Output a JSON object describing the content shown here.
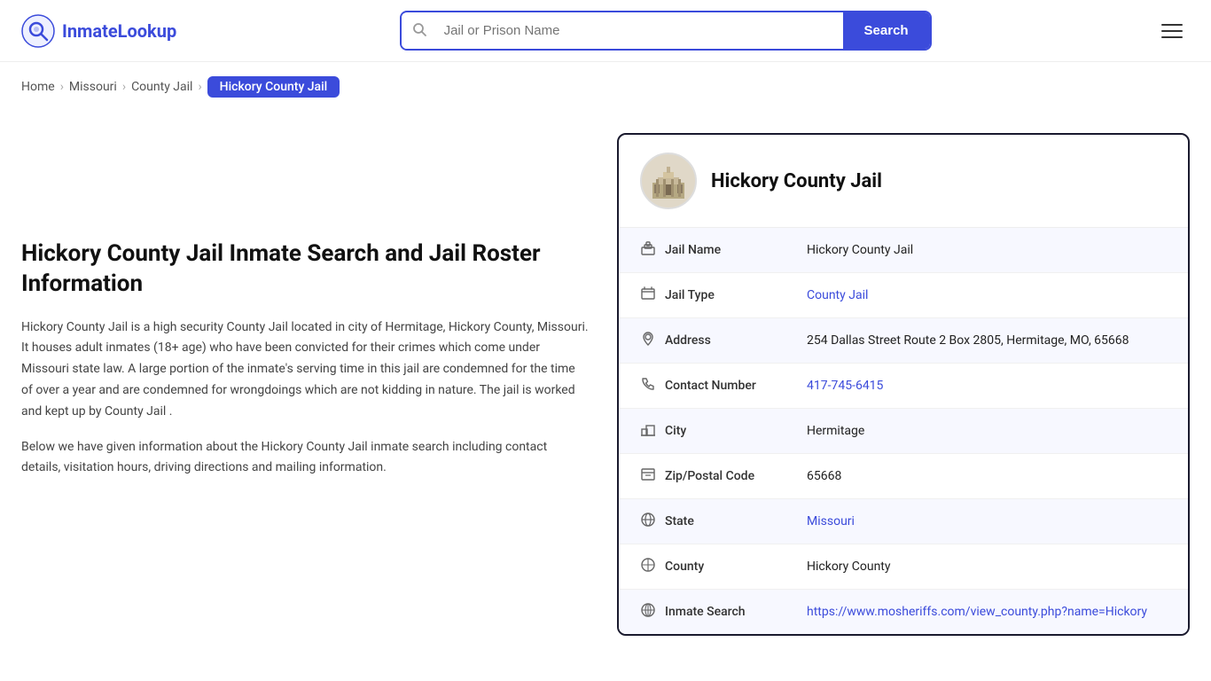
{
  "logo": {
    "text": "InmateLookup",
    "icon_alt": "inmate-lookup-logo"
  },
  "search": {
    "placeholder": "Jail or Prison Name",
    "button_label": "Search"
  },
  "breadcrumb": {
    "items": [
      {
        "label": "Home",
        "href": "#"
      },
      {
        "label": "Missouri",
        "href": "#"
      },
      {
        "label": "County Jail",
        "href": "#"
      },
      {
        "label": "Hickory County Jail",
        "current": true
      }
    ]
  },
  "left": {
    "heading": "Hickory County Jail Inmate Search and Jail Roster Information",
    "desc1": "Hickory County Jail is a high security County Jail located in city of Hermitage, Hickory County, Missouri. It houses adult inmates (18+ age) who have been convicted for their crimes which come under Missouri state law. A large portion of the inmate's serving time in this jail are condemned for the time of over a year and are condemned for wrongdoings which are not kidding in nature. The jail is worked and kept up by County Jail .",
    "desc2": "Below we have given information about the Hickory County Jail inmate search including contact details, visitation hours, driving directions and mailing information."
  },
  "card": {
    "title": "Hickory County Jail",
    "rows": [
      {
        "icon": "jail-icon",
        "label": "Jail Name",
        "value": "Hickory County Jail",
        "link": null
      },
      {
        "icon": "type-icon",
        "label": "Jail Type",
        "value": "County Jail",
        "link": "#"
      },
      {
        "icon": "address-icon",
        "label": "Address",
        "value": "254 Dallas Street Route 2 Box 2805, Hermitage, MO, 65668",
        "link": null
      },
      {
        "icon": "phone-icon",
        "label": "Contact Number",
        "value": "417-745-6415",
        "link": "tel:417-745-6415"
      },
      {
        "icon": "city-icon",
        "label": "City",
        "value": "Hermitage",
        "link": null
      },
      {
        "icon": "zip-icon",
        "label": "Zip/Postal Code",
        "value": "65668",
        "link": null
      },
      {
        "icon": "state-icon",
        "label": "State",
        "value": "Missouri",
        "link": "#"
      },
      {
        "icon": "county-icon",
        "label": "County",
        "value": "Hickory County",
        "link": null
      },
      {
        "icon": "inmate-search-icon",
        "label": "Inmate Search",
        "value": "https://www.mosheriffs.com/view_county.php?name=Hickory",
        "link": "https://www.mosheriffs.com/view_county.php?name=Hickory"
      }
    ]
  }
}
